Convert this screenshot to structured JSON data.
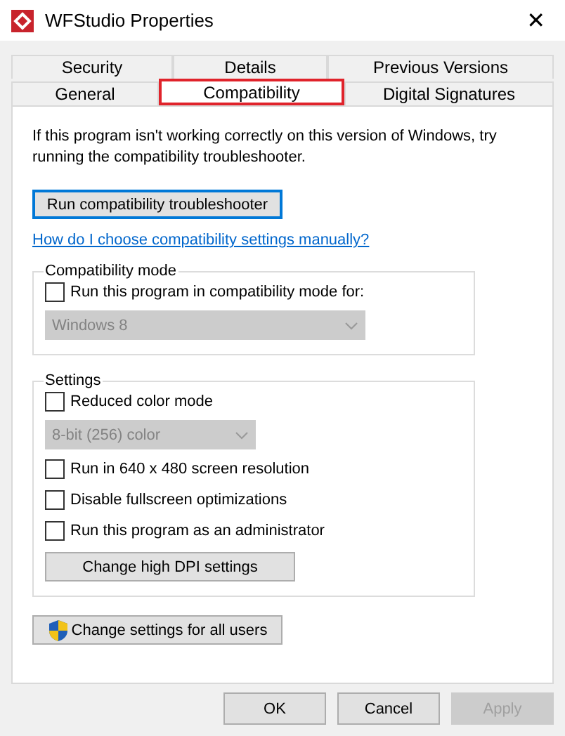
{
  "window": {
    "title": "WFStudio Properties",
    "close": "✕"
  },
  "tab_rows": [
    [
      {
        "label": "Security",
        "selected": false,
        "highlighted": false
      },
      {
        "label": "Details",
        "selected": false,
        "highlighted": false
      },
      {
        "label": "Previous Versions",
        "selected": false,
        "highlighted": false
      }
    ],
    [
      {
        "label": "General",
        "selected": false,
        "highlighted": false
      },
      {
        "label": "Compatibility",
        "selected": true,
        "highlighted": true
      },
      {
        "label": "Digital Signatures",
        "selected": false,
        "highlighted": false
      }
    ]
  ],
  "description": "If this program isn't working correctly on this version of Windows, try running the compatibility troubleshooter.",
  "troubleshooter_button": {
    "label": "Run compatibility troubleshooter",
    "focused": true
  },
  "help_link": "How do I choose compatibility settings manually?",
  "groups": [
    {
      "title": "Compatibility mode",
      "items": [
        {
          "kind": "checkbox",
          "label": "Run this program in compatibility mode for:",
          "checked": false
        },
        {
          "kind": "dropdown",
          "value": "Windows 8",
          "disabled": true
        }
      ]
    },
    {
      "title": "Settings",
      "items": [
        {
          "kind": "checkbox",
          "label": "Reduced color mode",
          "checked": false
        },
        {
          "kind": "dropdown",
          "value": "8-bit (256) color",
          "disabled": true
        },
        {
          "kind": "checkbox",
          "label": "Run in 640 x 480 screen resolution",
          "checked": false
        },
        {
          "kind": "checkbox",
          "label": "Disable fullscreen optimizations",
          "checked": false
        },
        {
          "kind": "checkbox",
          "label": "Run this program as an administrator",
          "checked": false
        },
        {
          "kind": "button",
          "label": "Change high DPI settings"
        }
      ]
    }
  ],
  "all_users_button": {
    "label": "Change settings for all users"
  },
  "buttons": [
    {
      "label": "OK",
      "disabled": false
    },
    {
      "label": "Cancel",
      "disabled": false
    },
    {
      "label": "Apply",
      "disabled": true
    }
  ]
}
